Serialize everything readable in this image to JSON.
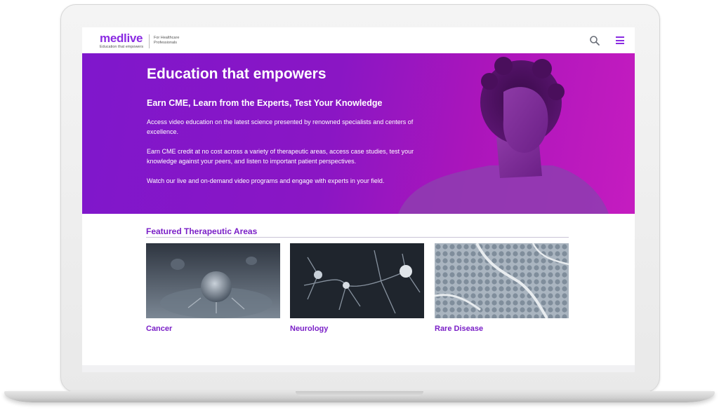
{
  "brand": {
    "name": "medlive",
    "tagline": "Education that empowers",
    "audience": "For Healthcare Professionals",
    "color": "#8a2be2"
  },
  "nav": {
    "icons": [
      "search-icon",
      "hamburger-menu-icon"
    ]
  },
  "hero": {
    "title": "Education that empowers",
    "subtitle": "Earn CME, Learn from the Experts, Test Your Knowledge",
    "paragraphs": [
      "Access video education on the latest science presented by renowned specialists and centers of excellence.",
      "Earn CME credit at no cost across a variety of therapeutic areas, access case studies, test your knowledge against your peers, and listen to important patient perspectives.",
      "Watch our live and on-demand video programs and engage with experts in your field."
    ],
    "gradient_colors": [
      "#7f17cc",
      "#c51cc0"
    ]
  },
  "featured": {
    "title": "Featured Therapeutic Areas",
    "accent_color": "#7a1fc7",
    "areas": [
      {
        "label": "Cancer"
      },
      {
        "label": "Neurology"
      },
      {
        "label": "Rare Disease"
      }
    ]
  }
}
